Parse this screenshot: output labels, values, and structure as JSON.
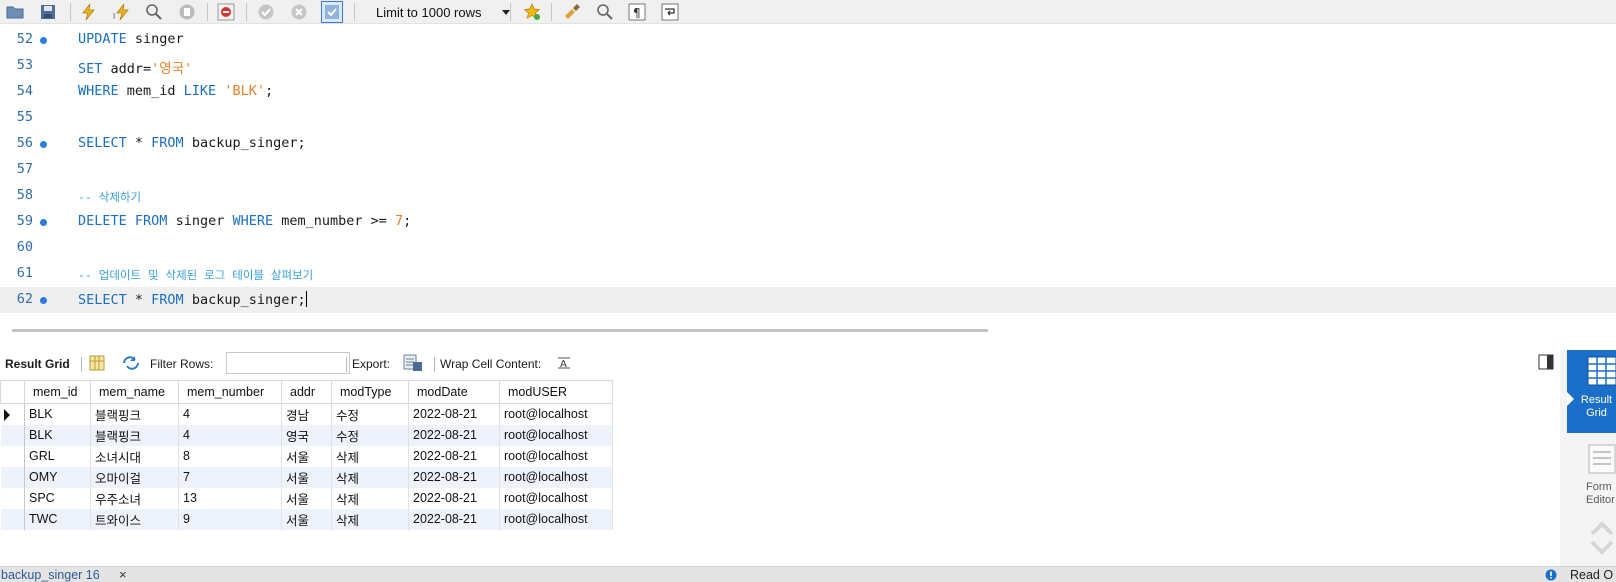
{
  "toolbar": {
    "limit_select": "Limit to 1000 rows"
  },
  "editor": {
    "lines": [
      {
        "num": "52",
        "kw1": "UPDATE",
        "t1": " singer"
      },
      {
        "num": "53",
        "kw1": "SET",
        "t1": " addr=",
        "str1": "'영국'"
      },
      {
        "num": "54",
        "kw1": "WHERE",
        "t1": " mem_id ",
        "kw2": "LIKE",
        "t2": " ",
        "str1": "'BLK'",
        "t3": ";"
      },
      {
        "num": "55"
      },
      {
        "num": "56",
        "kw1": "SELECT",
        "t1": " * ",
        "kw2": "FROM",
        "t2": " backup_singer;"
      },
      {
        "num": "57"
      },
      {
        "num": "58",
        "comment": "-- 삭제하기"
      },
      {
        "num": "59",
        "kw1": "DELETE",
        "t1": " ",
        "kw2": "FROM",
        "t2": " singer ",
        "kw3": "WHERE",
        "t3": " mem_number >= ",
        "num1": "7",
        "t4": ";"
      },
      {
        "num": "60"
      },
      {
        "num": "61",
        "comment": "-- 업데이트 및 삭제된 로그 테이블 살펴보기"
      },
      {
        "num": "62",
        "kw1": "SELECT",
        "t1": " * ",
        "kw2": "FROM",
        "t2": " backup_singer;"
      }
    ]
  },
  "result_toolbar": {
    "result_grid_label": "Result Grid",
    "filter_rows_label": "Filter Rows:",
    "filter_value": "",
    "export_label": "Export:",
    "wrap_label": "Wrap Cell Content:"
  },
  "grid": {
    "columns": [
      "mem_id",
      "mem_name",
      "mem_number",
      "addr",
      "modType",
      "modDate",
      "modUSER"
    ],
    "rows": [
      [
        "BLK",
        "블랙핑크",
        "4",
        "경남",
        "수정",
        "2022-08-21",
        "root@localhost"
      ],
      [
        "BLK",
        "블랙핑크",
        "4",
        "영국",
        "수정",
        "2022-08-21",
        "root@localhost"
      ],
      [
        "GRL",
        "소녀시대",
        "8",
        "서울",
        "삭제",
        "2022-08-21",
        "root@localhost"
      ],
      [
        "OMY",
        "오마이걸",
        "7",
        "서울",
        "삭제",
        "2022-08-21",
        "root@localhost"
      ],
      [
        "SPC",
        "우주소녀",
        "13",
        "서울",
        "삭제",
        "2022-08-21",
        "root@localhost"
      ],
      [
        "TWC",
        "트와이스",
        "9",
        "서울",
        "삭제",
        "2022-08-21",
        "root@localhost"
      ]
    ]
  },
  "side_panel": {
    "result_grid_line1": "Result",
    "result_grid_line2": "Grid",
    "form_editor_line1": "Form",
    "form_editor_line2": "Editor"
  },
  "statusbar": {
    "tab_label": "backup_singer 16",
    "close_glyph": "×",
    "read_only": "Read O"
  }
}
